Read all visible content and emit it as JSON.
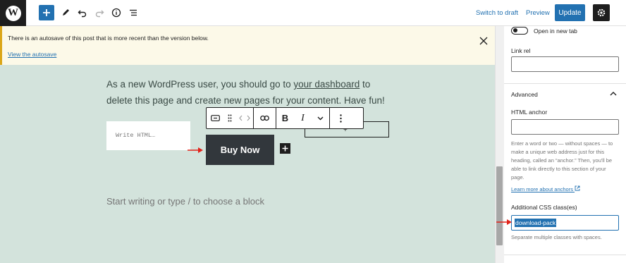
{
  "toolbar": {
    "switch_to_draft": "Switch to draft",
    "preview": "Preview",
    "update": "Update"
  },
  "notice": {
    "message": "There is an autosave of this post that is more recent than the version below.",
    "link": "View the autosave"
  },
  "content": {
    "paragraph_before": "As a new WordPress user, you should go to ",
    "paragraph_link": "your dashboard",
    "paragraph_after": " to delete this page and create new pages for your content. Have fun!",
    "html_placeholder": "Write HTML…",
    "outline_plus": "+",
    "button_label": "Buy Now",
    "block_placeholder": "Start writing or type / to choose a block"
  },
  "sidebar": {
    "open_new_tab": "Open in new tab",
    "link_rel": "Link rel",
    "advanced": "Advanced",
    "html_anchor": "HTML anchor",
    "anchor_help": "Enter a word or two — without spaces — to make a unique web address just for this heading, called an “anchor.” Then, you'll be able to link directly to this section of your page.",
    "learn_more": "Learn more about anchors",
    "css_label": "Additional CSS class(es)",
    "css_value": "download-pack",
    "css_help": "Separate multiple classes with spaces."
  },
  "colors": {
    "accent": "#2271b1",
    "canvas_bg": "#d3e3dc",
    "notice_bg": "#fcf9e8",
    "button_bg": "#32373c",
    "annotation_arrow": "#e2231a"
  }
}
